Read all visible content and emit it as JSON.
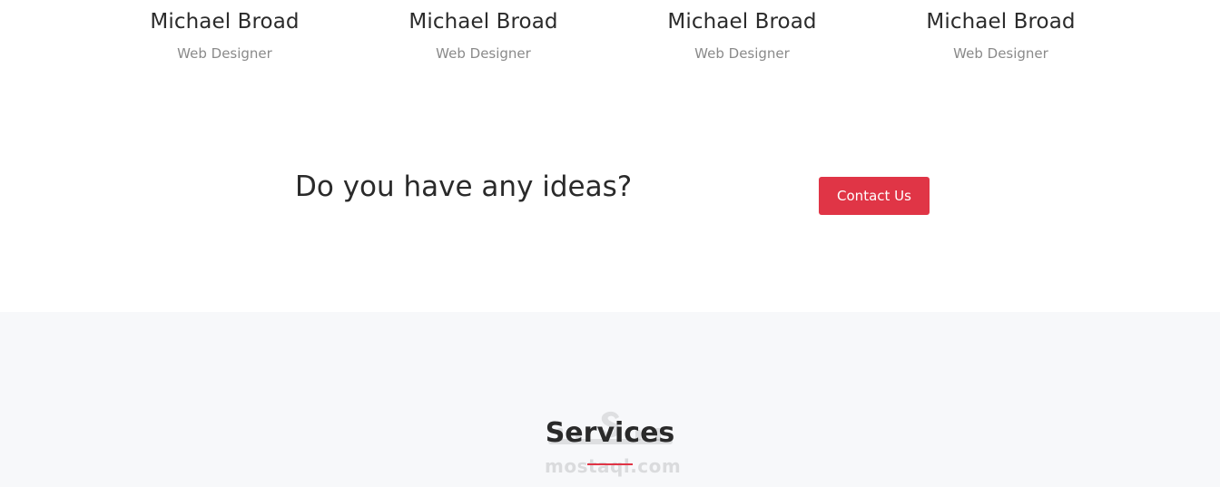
{
  "team": {
    "members": [
      {
        "name": "Michael Broad",
        "role": "Web Designer"
      },
      {
        "name": "Michael Broad",
        "role": "Web Designer"
      },
      {
        "name": "Michael Broad",
        "role": "Web Designer"
      },
      {
        "name": "Michael Broad",
        "role": "Web Designer"
      }
    ]
  },
  "cta": {
    "heading": "Do you have any ideas?",
    "button_label": "Contact Us"
  },
  "services": {
    "title": "Services"
  },
  "watermark": {
    "text": "mostaql.com"
  },
  "colors": {
    "accent": "#e03546",
    "section_bg": "#f7f8fa",
    "muted_text": "#8a8a8a",
    "heading_text": "#2a2a2a"
  }
}
